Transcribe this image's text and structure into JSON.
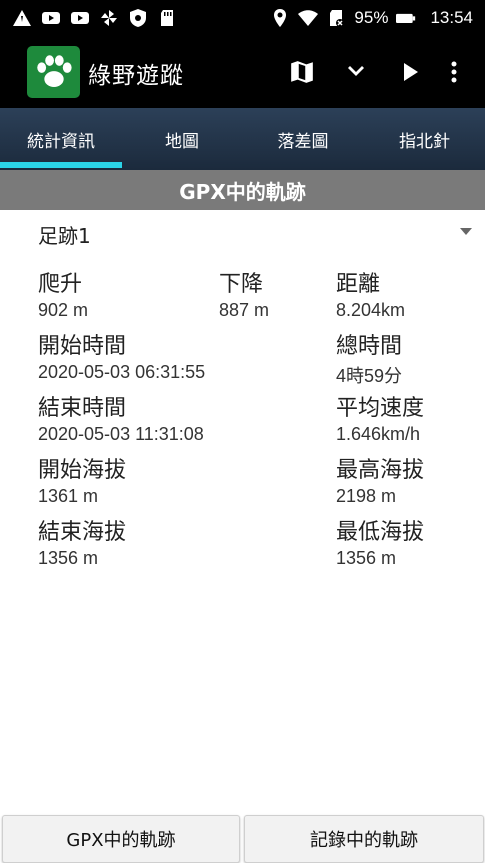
{
  "statusbar": {
    "battery": "95%",
    "time": "13:54"
  },
  "appbar": {
    "title": "綠野遊蹤"
  },
  "tabs": [
    {
      "label": "統計資訊"
    },
    {
      "label": "地圖"
    },
    {
      "label": "落差圖"
    },
    {
      "label": "指北針"
    }
  ],
  "section": {
    "title": "GPX中的軌跡"
  },
  "track_select": {
    "value": "足跡1"
  },
  "stats": {
    "climb": {
      "label": "爬升",
      "value": "902 m"
    },
    "descent": {
      "label": "下降",
      "value": "887 m"
    },
    "distance": {
      "label": "距離",
      "value": "8.204km"
    },
    "start_time": {
      "label": "開始時間",
      "value": "2020-05-03 06:31:55"
    },
    "total_time": {
      "label": "總時間",
      "value": "4時59分"
    },
    "end_time": {
      "label": "結束時間",
      "value": "2020-05-03 11:31:08"
    },
    "avg_speed": {
      "label": "平均速度",
      "value": "1.646km/h"
    },
    "start_altitude": {
      "label": "開始海拔",
      "value": "1361 m"
    },
    "max_altitude": {
      "label": "最高海拔",
      "value": "2198 m"
    },
    "end_altitude": {
      "label": "結束海拔",
      "value": "1356 m"
    },
    "min_altitude": {
      "label": "最低海拔",
      "value": "1356 m"
    }
  },
  "bottom": {
    "gpx_button": "GPX中的軌跡",
    "recorded_button": "記錄中的軌跡"
  },
  "colors": {
    "tab_indicator": "#2bd4e8",
    "logo_bg": "#1e8a3c",
    "header_bg": "#7a7a7a"
  }
}
